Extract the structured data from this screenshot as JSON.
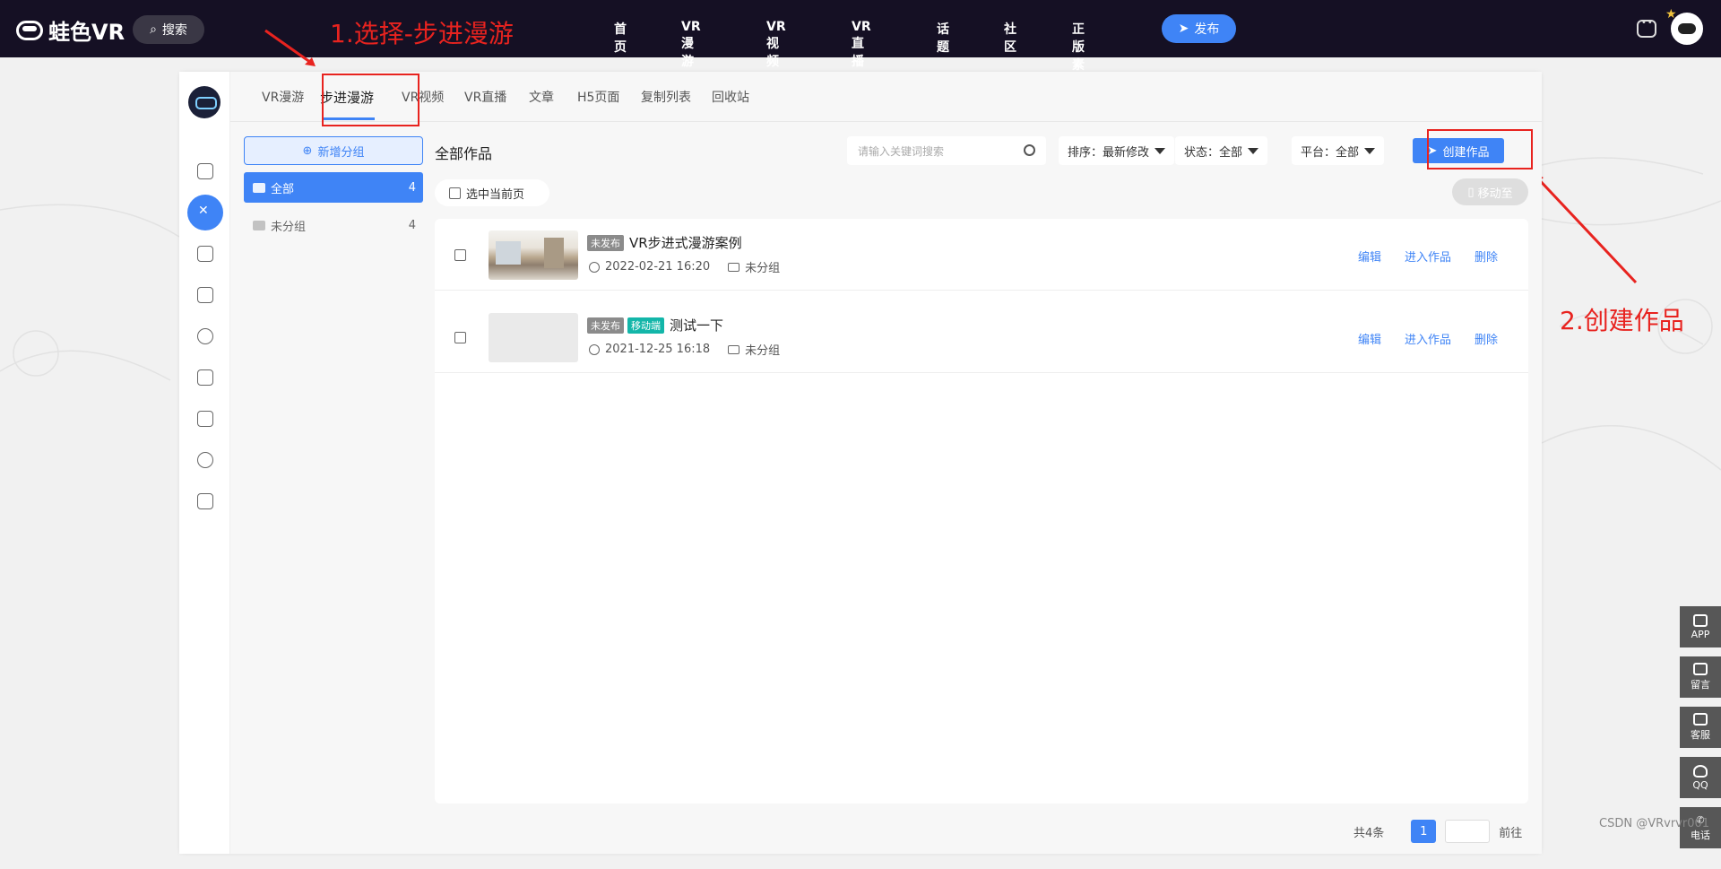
{
  "topbar": {
    "logo_text": "蛙色VR",
    "search_label": "搜索",
    "nav": [
      "首页",
      "VR漫游",
      "VR视频",
      "VR直播",
      "话题",
      "社区",
      "正版素材"
    ],
    "publish_label": "发布"
  },
  "annotations": {
    "step1": "1.选择-步进漫游",
    "step2": "2.创建作品"
  },
  "tabs": [
    "VR漫游",
    "步进漫游",
    "VR视频",
    "VR直播",
    "文章",
    "H5页面",
    "复制列表",
    "回收站"
  ],
  "groups": {
    "add_label": "新增分组",
    "items": [
      {
        "name": "全部",
        "count": "4"
      },
      {
        "name": "未分组",
        "count": "4"
      }
    ]
  },
  "toolbar": {
    "title": "全部作品",
    "search_placeholder": "请输入关键词搜索",
    "sort": "排序：最新修改",
    "status": "状态：全部",
    "platform": "平台：全部",
    "create_label": "创建作品",
    "select_page_label": "选中当前页",
    "move_label": "移动至"
  },
  "works": [
    {
      "status_tag": "未发布",
      "platform_tag": "",
      "title": "VR步进式漫游案例",
      "time": "2022-02-21 16:20",
      "group": "未分组"
    },
    {
      "status_tag": "未发布",
      "platform_tag": "移动端",
      "title": "测试一下",
      "time": "2021-12-25 16:18",
      "group": "未分组"
    }
  ],
  "row_actions": {
    "edit": "编辑",
    "enter": "进入作品",
    "delete": "删除"
  },
  "pager": {
    "total": "共4条",
    "page": "1",
    "goto": "前往"
  },
  "floatbar": [
    "APP",
    "留言",
    "客服",
    "QQ",
    "电话"
  ],
  "watermark": "CSDN @VRvrvr001",
  "colors": {
    "accent": "#3f84f6",
    "topbar": "#151024",
    "annotation": "#e8231f"
  }
}
